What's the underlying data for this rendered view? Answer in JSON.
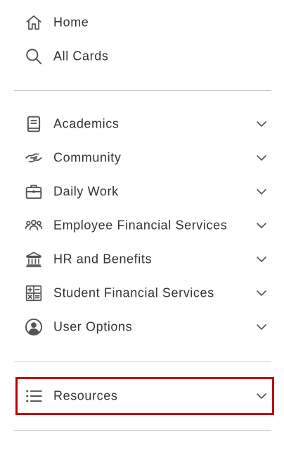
{
  "nav": {
    "top": [
      {
        "label": "Home",
        "icon": "home-icon"
      },
      {
        "label": "All Cards",
        "icon": "search-icon"
      }
    ],
    "sections": [
      {
        "label": "Academics",
        "icon": "book-icon"
      },
      {
        "label": "Community",
        "icon": "handshake-icon"
      },
      {
        "label": "Daily Work",
        "icon": "briefcase-icon"
      },
      {
        "label": "Employee Financial Services",
        "icon": "people-group-icon"
      },
      {
        "label": "HR and Benefits",
        "icon": "bank-icon"
      },
      {
        "label": "Student Financial Services",
        "icon": "calculator-icon"
      },
      {
        "label": "User Options",
        "icon": "user-circle-icon"
      }
    ],
    "resources": {
      "label": "Resources",
      "icon": "list-icon"
    }
  },
  "colors": {
    "text": "#333333",
    "icon": "#555555",
    "divider": "#c8c8c8",
    "highlight": "#c00000"
  }
}
